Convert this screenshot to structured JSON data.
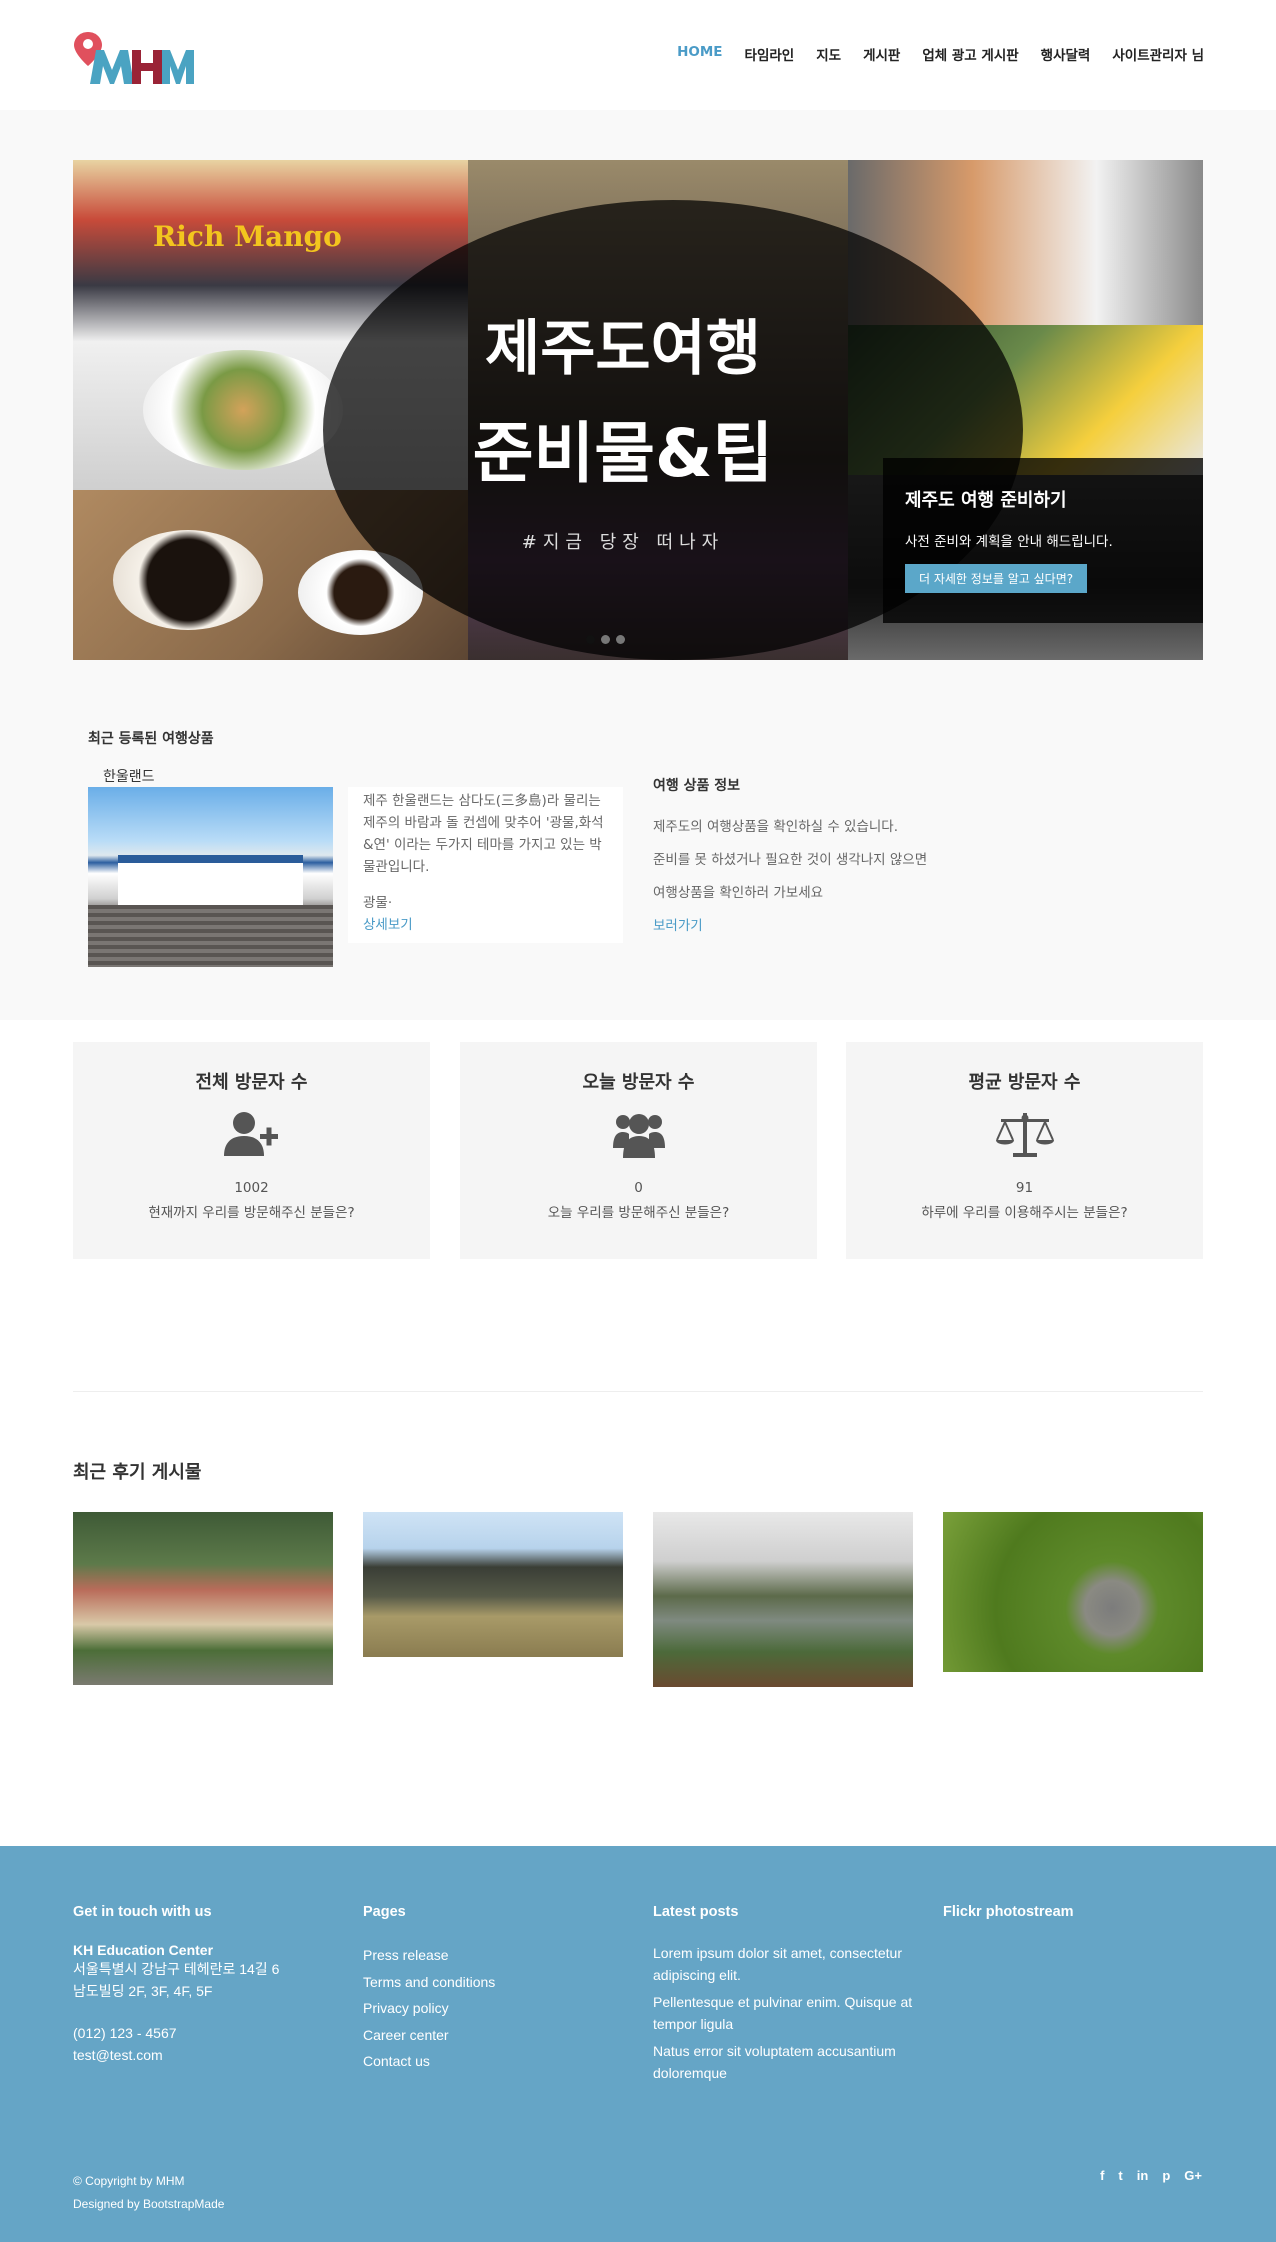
{
  "header": {
    "logo_text": "MHM",
    "nav": [
      "HOME",
      "타임라인",
      "지도",
      "게시판",
      "업체 광고 게시판",
      "행사달력",
      "사이트관리자 님"
    ]
  },
  "slider": {
    "image_text_line1": "제주도여행",
    "image_text_line2": "준비물&팁",
    "image_text_tag": "#지금 당장 떠나자",
    "image_sign": "Rich Mango",
    "caption_title": "제주도 여행 준비하기",
    "caption_text": "사전 준비와 계획을 안내 해드립니다.",
    "caption_button": "더 자세한 정보를 알고 싶다면?"
  },
  "recent": {
    "section_title": "최근 등록된 여행상품",
    "product_name": "한울랜드",
    "description": "제주 한울랜드는 삼다도(三多島)라 물리는 제주의 바람과 돌 컨셉에 맞추어 '광물,화석&연' 이라는 두가지 테마를 가지고 있는 박물관입니다.",
    "type_label": "광물·",
    "detail_link": "상세보기",
    "info_title": "여행 상품 정보",
    "info_lines": [
      "제주도의 여행상품을 확인하실 수 있습니다.",
      "준비를 못 하셨거나 필요한 것이 생각나지 않으면",
      "여행상품을 확인하러 가보세요"
    ],
    "info_link": "보러가기"
  },
  "stats": [
    {
      "title": "전체 방문자 수",
      "icon": "user-plus-icon",
      "value": "1002",
      "caption": "현재까지 우리를 방문해주신 분들은?"
    },
    {
      "title": "오늘 방문자 수",
      "icon": "users-icon",
      "value": "0",
      "caption": "오늘 우리를 방문해주신 분들은?"
    },
    {
      "title": "평균 방문자 수",
      "icon": "balance-scale-icon",
      "value": "91",
      "caption": "하루에 우리를 이용해주시는 분들은?"
    }
  ],
  "reviews": {
    "section_title": "최근 후기 게시물"
  },
  "footer": {
    "contact_title": "Get in touch with us",
    "org_name": "KH Education Center",
    "address1": "서울특별시 강남구 테헤란로 14길 6",
    "address2": "남도빌딩 2F, 3F, 4F, 5F",
    "phone": "(012) 123 - 4567",
    "email": "test@test.com",
    "pages_title": "Pages",
    "pages": [
      "Press release",
      "Terms and conditions",
      "Privacy policy",
      "Career center",
      "Contact us"
    ],
    "posts_title": "Latest posts",
    "posts": [
      "Lorem ipsum dolor sit amet, consectetur adipiscing elit.",
      "Pellentesque et pulvinar enim. Quisque at tempor ligula",
      "Natus error sit voluptatem accusantium doloremque"
    ],
    "flickr_title": "Flickr photostream",
    "copyright": "© Copyright by MHM",
    "designed": "Designed by BootstrapMade",
    "social": [
      "f",
      "t",
      "in",
      "p",
      "G+"
    ]
  },
  "colors": {
    "accent": "#4a9bc7",
    "footer_bg": "#65a5c6",
    "band_bg": "#f9f9f9"
  }
}
